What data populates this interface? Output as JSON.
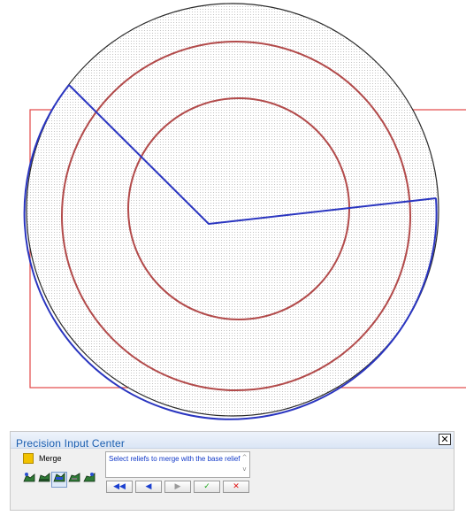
{
  "panel": {
    "title": "Precision Input Center",
    "close_label": "✕",
    "merge": {
      "label": "Merge",
      "swatch_color": "#f2c200"
    },
    "prompt": {
      "text": "Select reliefs to merge with the base relief",
      "scroll_up": "^",
      "scroll_down": "v"
    },
    "tool_icons": [
      "relief-icon-1",
      "relief-icon-2",
      "relief-icon-3",
      "relief-icon-4",
      "relief-icon-5"
    ],
    "nav_buttons": [
      {
        "name": "first-button",
        "glyph": "◀◀",
        "color": "#1a3fd0"
      },
      {
        "name": "previous-button",
        "glyph": "◀",
        "color": "#1a3fd0"
      },
      {
        "name": "next-button",
        "glyph": "▶",
        "color": "#9a9a9a"
      },
      {
        "name": "accept-button",
        "glyph": "✓",
        "color": "#1aa81a"
      },
      {
        "name": "cancel-button",
        "glyph": "✕",
        "color": "#e01010"
      }
    ]
  },
  "colors": {
    "outer_circle": "#2b2b2b",
    "red_circles": "#b24a4a",
    "blue_vectors": "#2a35c0",
    "bounding_box": "#e24848",
    "hatch": "#bdbdbd"
  }
}
